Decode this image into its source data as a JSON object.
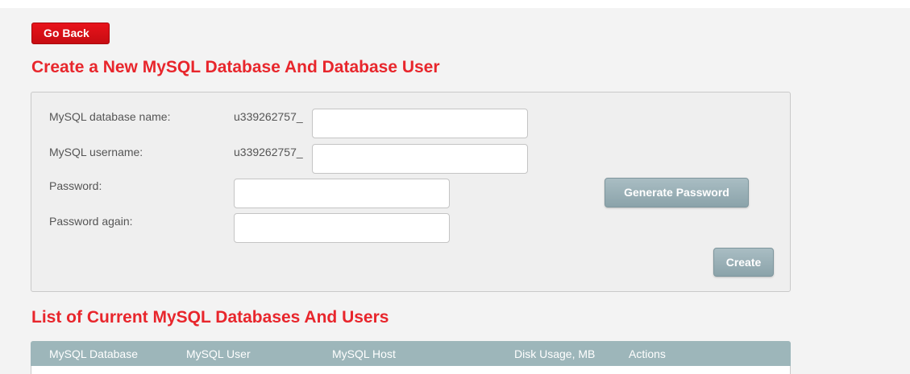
{
  "nav": {
    "go_back_label": "Go Back"
  },
  "create_section": {
    "title": "Create a New MySQL Database And Database User",
    "db_name_label": "MySQL database name:",
    "db_name_prefix": "u339262757_",
    "db_name_value": "",
    "username_label": "MySQL username:",
    "username_prefix": "u339262757_",
    "username_value": "",
    "password_label": "Password:",
    "password_value": "",
    "password_again_label": "Password again:",
    "password_again_value": "",
    "generate_password_label": "Generate Password",
    "create_label": "Create"
  },
  "list_section": {
    "title": "List of Current MySQL Databases And Users",
    "columns": [
      "MySQL Database",
      "MySQL User",
      "MySQL Host",
      "Disk Usage, MB",
      "Actions"
    ]
  },
  "colors": {
    "accent_red": "#e8262c",
    "button_red": "#d8101a",
    "button_grey": "#96adb3",
    "table_header": "#9db6ba",
    "panel_bg": "#efefef"
  }
}
